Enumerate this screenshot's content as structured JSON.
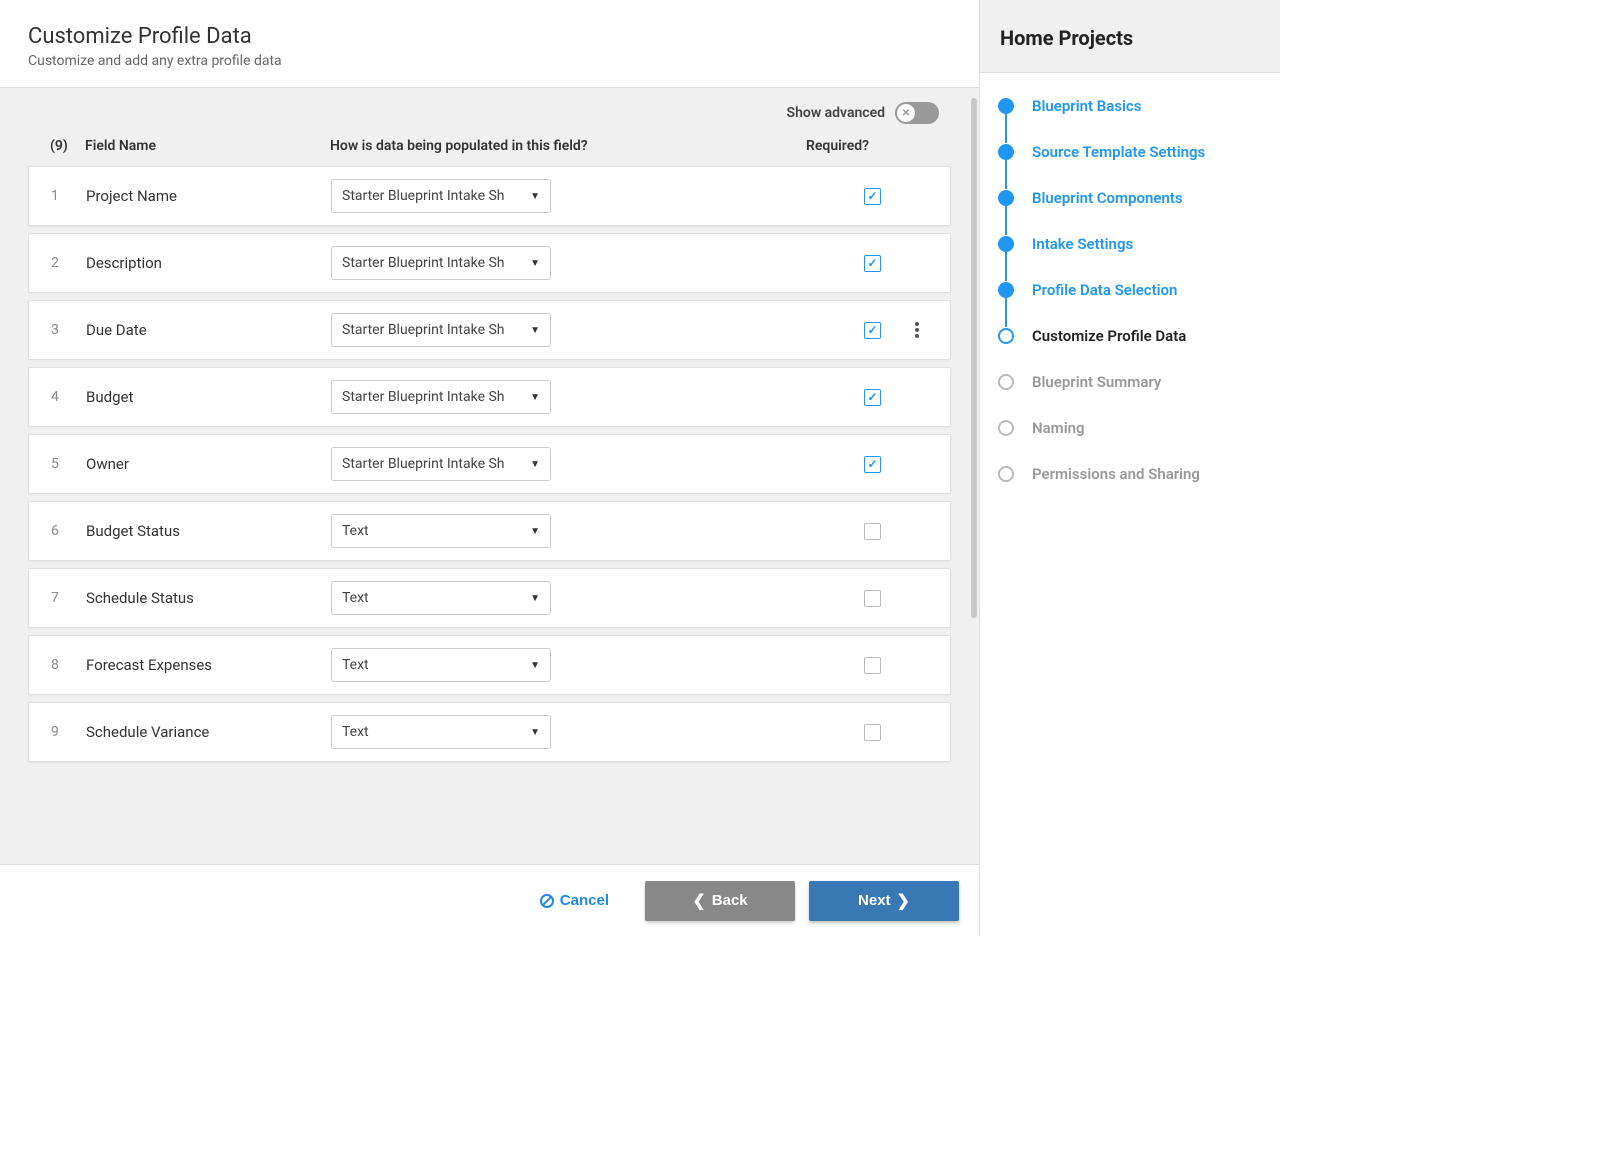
{
  "header": {
    "title": "Customize Profile Data",
    "subtitle": "Customize and add any extra profile data"
  },
  "toolbar": {
    "show_advanced_label": "Show advanced"
  },
  "table": {
    "count_label": "(9)",
    "head_name": "Field Name",
    "head_populated": "How is data being populated in this field?",
    "head_required": "Required?",
    "rows": [
      {
        "idx": "1",
        "name": "Project Name",
        "populated": "Starter Blueprint Intake Sh",
        "required": true,
        "menu": false
      },
      {
        "idx": "2",
        "name": "Description",
        "populated": "Starter Blueprint Intake Sh",
        "required": true,
        "menu": false
      },
      {
        "idx": "3",
        "name": "Due Date",
        "populated": "Starter Blueprint Intake Sh",
        "required": true,
        "menu": true
      },
      {
        "idx": "4",
        "name": "Budget",
        "populated": "Starter Blueprint Intake Sh",
        "required": true,
        "menu": false
      },
      {
        "idx": "5",
        "name": "Owner",
        "populated": "Starter Blueprint Intake Sh",
        "required": true,
        "menu": false
      },
      {
        "idx": "6",
        "name": "Budget Status",
        "populated": "Text",
        "required": false,
        "menu": false
      },
      {
        "idx": "7",
        "name": "Schedule Status",
        "populated": "Text",
        "required": false,
        "menu": false
      },
      {
        "idx": "8",
        "name": "Forecast Expenses",
        "populated": "Text",
        "required": false,
        "menu": false
      },
      {
        "idx": "9",
        "name": "Schedule Variance",
        "populated": "Text",
        "required": false,
        "menu": false
      }
    ]
  },
  "footer": {
    "cancel": "Cancel",
    "back": "Back",
    "next": "Next"
  },
  "sidebar": {
    "title": "Home Projects",
    "steps": [
      {
        "label": "Blueprint Basics",
        "state": "done"
      },
      {
        "label": "Source Template Settings",
        "state": "done"
      },
      {
        "label": "Blueprint Components",
        "state": "done"
      },
      {
        "label": "Intake Settings",
        "state": "done"
      },
      {
        "label": "Profile Data Selection",
        "state": "done"
      },
      {
        "label": "Customize Profile Data",
        "state": "current"
      },
      {
        "label": "Blueprint Summary",
        "state": "pending"
      },
      {
        "label": "Naming",
        "state": "pending"
      },
      {
        "label": "Permissions and Sharing",
        "state": "pending"
      }
    ]
  }
}
